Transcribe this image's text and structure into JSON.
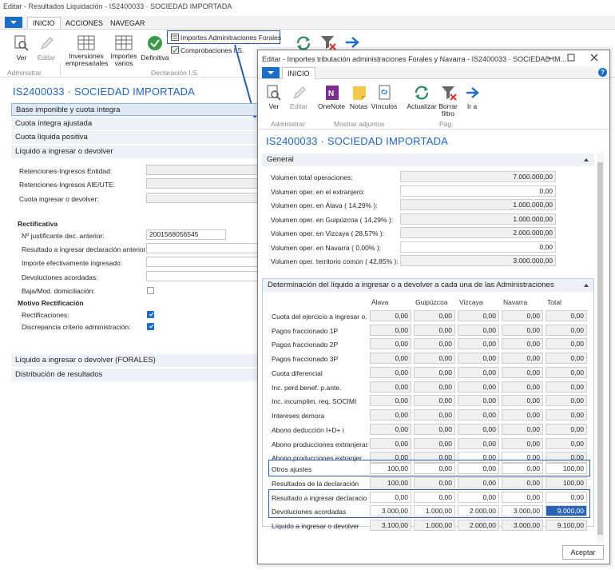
{
  "bg": {
    "title": "Editar - Resultados Liquidación - IS2400033 · SOCIEDAD IMPORTADA",
    "tabs": [
      "INICIO",
      "ACCIONES",
      "NAVEGAR"
    ],
    "ribbon": {
      "ver": "Ver",
      "editar": "Editar",
      "inversiones": "Inversiones empresariales",
      "importes_varios": "Importes varios",
      "definitiva": "Definitiva",
      "importes_admin": "Importes Adminitraciones Forales",
      "comprobaciones": "Comprobaciones I.S.",
      "group_admin": "Administrar",
      "group_decl": "Declaración I.S."
    },
    "heading": "IS2400033 · SOCIEDAD IMPORTADA",
    "sections": [
      "Base imponible y cuota íntegra",
      "Cuota íntegra ajustada",
      "Cuota líquida positiva",
      "Líquido a ingresar o devolver"
    ],
    "fields": {
      "ret_entidad": "Retenciones-Ingresos Entidad:",
      "ret_aie": "Retenciones-Ingresos AIE/UTE:",
      "cuota_ingresar": "Cuota ingresar o devolver:",
      "rectificativa": "Rectificativa",
      "justificante": "Nº justificante dec. anterior:",
      "justificante_value": "2001568056545",
      "resultado_anterior": "Resultado a ingresar declaración anterior:",
      "importe_ingresado": "Importe efectivamente ingresado:",
      "devoluciones": "Devoluciones acordadas:",
      "baja_mod": "Baja/Mod. domiciliación:",
      "motivo": "Motivo Rectificación",
      "rectificaciones": "Rectificaciones:",
      "discrepancia": "Discrepancia criterio administración:"
    },
    "sections_bottom": [
      "Líquido a ingresar o devolver (FORALES)",
      "Distribución de resultados"
    ]
  },
  "modal": {
    "title": "Editar - Importes tributación administraciones Forales y Navarra - IS2400033 · SOCIEDAD IM...",
    "tab": "INICIO",
    "ribbon": {
      "ver": "Ver",
      "editar": "Editar",
      "onenote": "OneNote",
      "notas": "Notas",
      "vinculos": "Vínculos",
      "actualizar": "Actualizar",
      "borrar_filtro": "Borrar filtro",
      "ir_a": "Ir a",
      "group_admin": "Administrar",
      "group_adjuntos": "Mostrar adjuntos",
      "group_pag": "Pág."
    },
    "heading": "IS2400033 · SOCIEDAD IMPORTADA",
    "general": {
      "title": "General",
      "rows": [
        {
          "label": "Volumen total operaciones:",
          "value": "7.000.000,00"
        },
        {
          "label": "Volumen oper. en el extranjero:",
          "value": "0,00"
        },
        {
          "label": "Volumen oper. en Álava ( 14,29% ):",
          "value": "1.000.000,00"
        },
        {
          "label": "Volumen oper. en Guipúzcoa ( 14,29% ):",
          "value": "1.000.000,00"
        },
        {
          "label": "Volumen oper. en Vizcaya ( 28,57% ):",
          "value": "2.000.000,00"
        },
        {
          "label": "Volumen oper. en Navarra ( 0,00% ):",
          "value": "0,00"
        },
        {
          "label": "Volumen oper. territorio común ( 42,85% ):",
          "value": "3.000.000,00"
        }
      ]
    },
    "determinacion": {
      "title": "Determinación del líquido a ingresar o a devolver a cada una de las Administraciones",
      "columns": [
        "Álava",
        "Guipúzcoa",
        "Vizcaya",
        "Navarra",
        "Total"
      ],
      "rows": [
        {
          "label": "Cuota del ejercicio a ingresar o...",
          "values": [
            "0,00",
            "0,00",
            "0,00",
            "0,00",
            "0,00"
          ]
        },
        {
          "label": "Pagos fraccionado 1P",
          "values": [
            "0,00",
            "0,00",
            "0,00",
            "0,00",
            "0,00"
          ]
        },
        {
          "label": "Pagos fraccionado 2P",
          "values": [
            "0,00",
            "0,00",
            "0,00",
            "0,00",
            "0,00"
          ]
        },
        {
          "label": "Pagos fraccionado 3P",
          "values": [
            "0,00",
            "0,00",
            "0,00",
            "0,00",
            "0,00"
          ]
        },
        {
          "label": "Cuota diferencial",
          "values": [
            "0,00",
            "0,00",
            "0,00",
            "0,00",
            "0,00"
          ]
        },
        {
          "label": "Inc. perd.benef. p.ante.",
          "values": [
            "0,00",
            "0,00",
            "0,00",
            "0,00",
            "0,00"
          ]
        },
        {
          "label": "Inc. incumplim. req. SOCIMI",
          "values": [
            "0,00",
            "0,00",
            "0,00",
            "0,00",
            "0,00"
          ]
        },
        {
          "label": "Intereses demora",
          "values": [
            "0,00",
            "0,00",
            "0,00",
            "0,00",
            "0,00"
          ]
        },
        {
          "label": "Abono deducción I+D+ i",
          "values": [
            "0,00",
            "0,00",
            "0,00",
            "0,00",
            "0,00"
          ]
        },
        {
          "label": "Abono producciones extranjeras",
          "values": [
            "0,00",
            "0,00",
            "0,00",
            "0,00",
            "0,00"
          ]
        },
        {
          "label": "Abono producciones extranjer...",
          "values": [
            "0,00",
            "0,00",
            "0,00",
            "0,00",
            "0,00"
          ]
        },
        {
          "label": "Otros ajustes",
          "values": [
            "100,00",
            "0,00",
            "0,00",
            "0,00",
            "100,00"
          ]
        },
        {
          "label": "Resultados de la declaración",
          "values": [
            "100,00",
            "0,00",
            "0,00",
            "0,00",
            "100,00"
          ]
        },
        {
          "label": "Resultado a ingresar declaracio...",
          "values": [
            "0,00",
            "0,00",
            "0,00",
            "0,00",
            "0,00"
          ]
        },
        {
          "label": "Devoluciones acordadas",
          "values": [
            "3.000,00",
            "1.000,00",
            "2.000,00",
            "3.000,00",
            "9.000,00"
          ]
        },
        {
          "label": "Líquido a ingresar o devolver",
          "values": [
            "3.100,00",
            "1.000,00",
            "2.000,00",
            "3.000,00",
            "9.100,00"
          ]
        }
      ]
    },
    "accept": "Aceptar",
    "help": "?"
  }
}
